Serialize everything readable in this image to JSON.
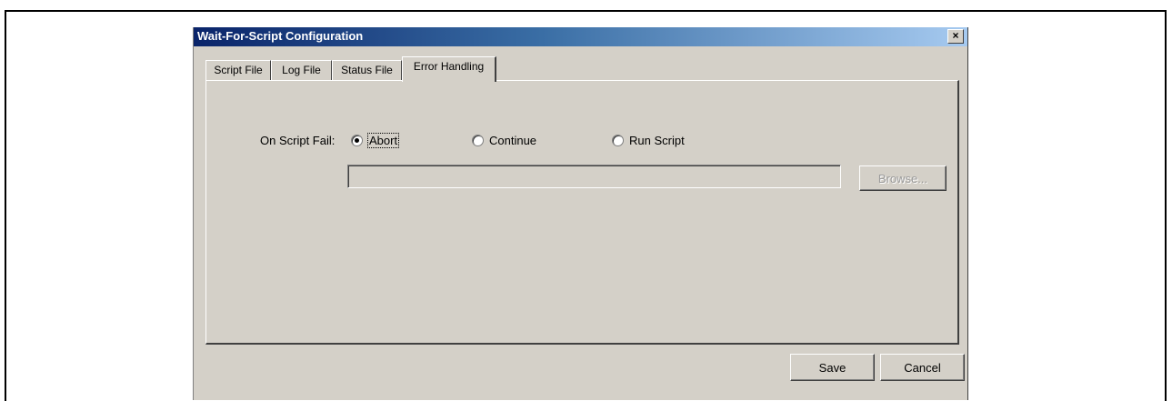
{
  "window": {
    "title": "Wait-For-Script Configuration",
    "close_glyph": "×"
  },
  "tabs": [
    {
      "label": "Script File",
      "active": false
    },
    {
      "label": "Log File",
      "active": false
    },
    {
      "label": "Status File",
      "active": false
    },
    {
      "label": "Error Handling",
      "active": true
    }
  ],
  "error_handling": {
    "on_script_fail_label": "On Script Fail:",
    "options": [
      {
        "label": "Abort",
        "checked": true
      },
      {
        "label": "Continue",
        "checked": false
      },
      {
        "label": "Run Script",
        "checked": false
      }
    ],
    "script_path_value": "",
    "browse_label": "Browse..."
  },
  "footer": {
    "save_label": "Save",
    "cancel_label": "Cancel"
  }
}
